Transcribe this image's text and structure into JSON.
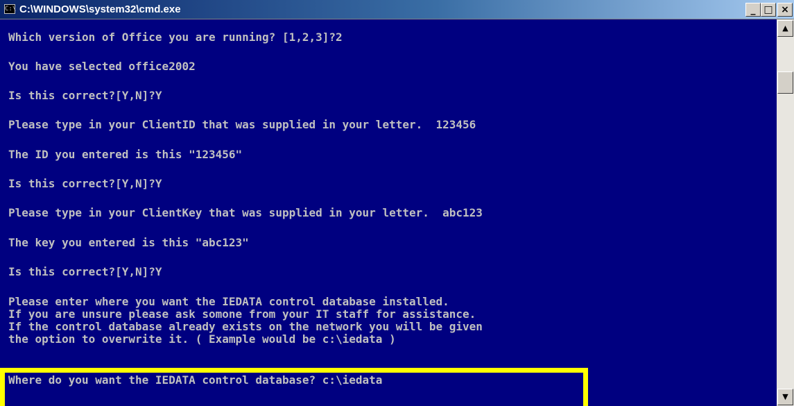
{
  "window": {
    "title": "C:\\WINDOWS\\system32\\cmd.exe",
    "icon_glyph": "C:\\",
    "buttons": {
      "minimize": "_",
      "maximize": "□",
      "close": "×"
    }
  },
  "console": {
    "lines": [
      "Which version of Office you are running? [1,2,3]?2",
      "You have selected office2002",
      "Is this correct?[Y,N]?Y",
      "Please type in your ClientID that was supplied in your letter.  123456",
      "The ID you entered is this \"123456\"",
      "Is this correct?[Y,N]?Y",
      "Please type in your ClientKey that was supplied in your letter.  abc123",
      "The key you entered is this \"abc123\"",
      "Is this correct?[Y,N]?Y",
      "Please enter where you want the IEDATA control database installed.",
      "If you are unsure please ask somone from your IT staff for assistance.",
      "If the control database already exists on the network you will be given",
      "the option to overwrite it. ( Example would be c:\\iedata )",
      "Where do you want the IEDATA control database? c:\\iedata"
    ],
    "text_color": "#c0c0c0",
    "background_color": "#000080"
  },
  "highlight": {
    "color": "#ffff00"
  },
  "scrollbar": {
    "up_arrow": "▲",
    "down_arrow": "▼"
  }
}
